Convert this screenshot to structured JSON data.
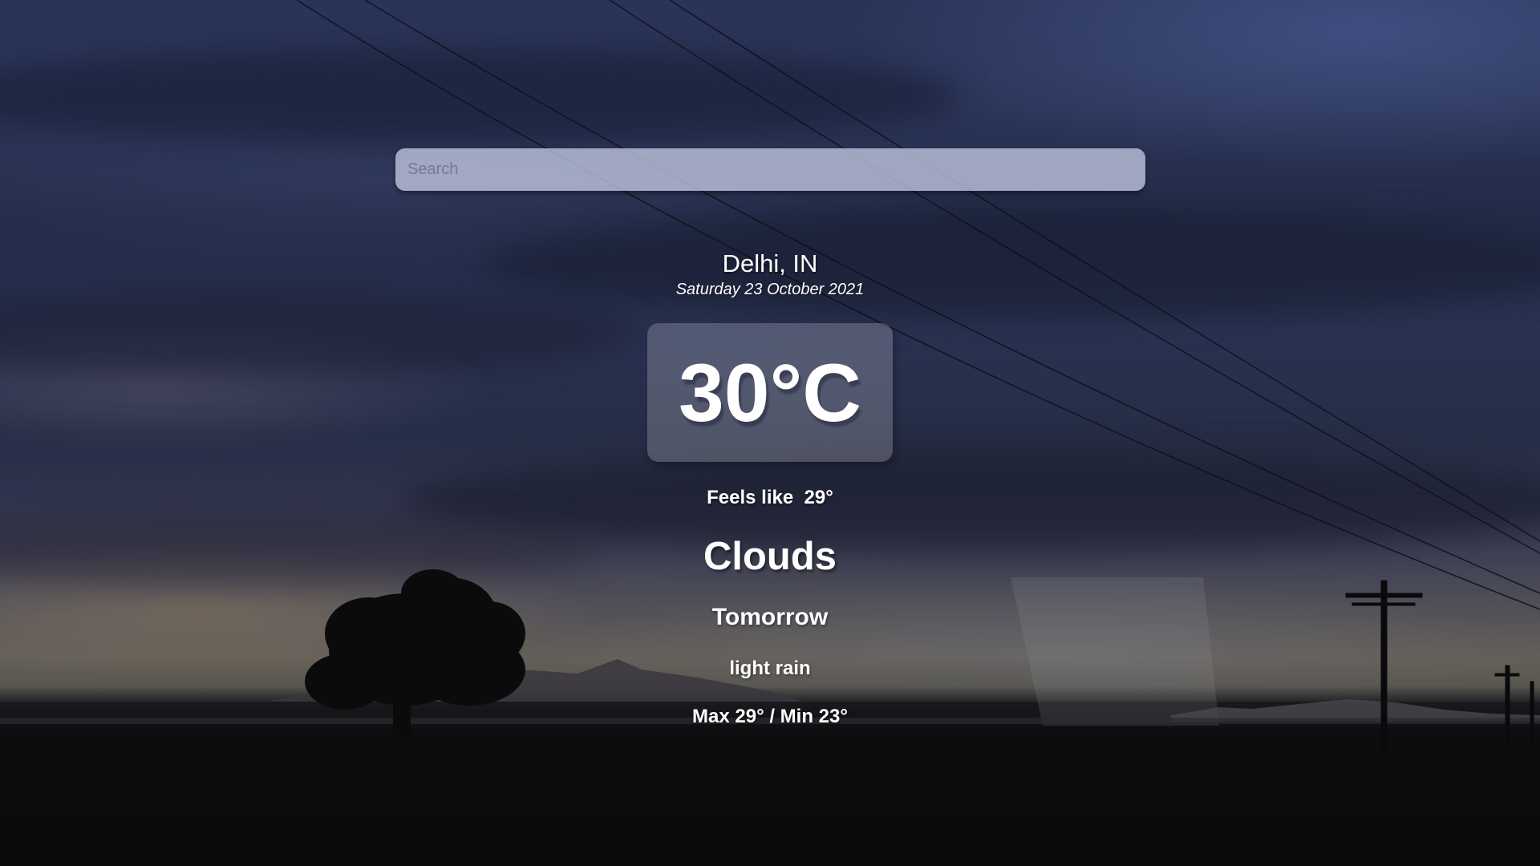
{
  "search": {
    "placeholder": "Search",
    "value": ""
  },
  "location": {
    "city": "Delhi, IN",
    "date": "Saturday 23 October 2021"
  },
  "current": {
    "temperature": "30°C",
    "feels_like": "Feels like  29°",
    "condition": "Clouds"
  },
  "forecast": {
    "heading": "Tomorrow",
    "description": "light rain",
    "range": "Max 29° / Min 23°"
  },
  "background": {
    "description_icon": "stormy-sky-background",
    "colors": {
      "sky_top": "#2a3458",
      "horizon": "#6b6658",
      "ground": "#0a0a0b"
    }
  }
}
